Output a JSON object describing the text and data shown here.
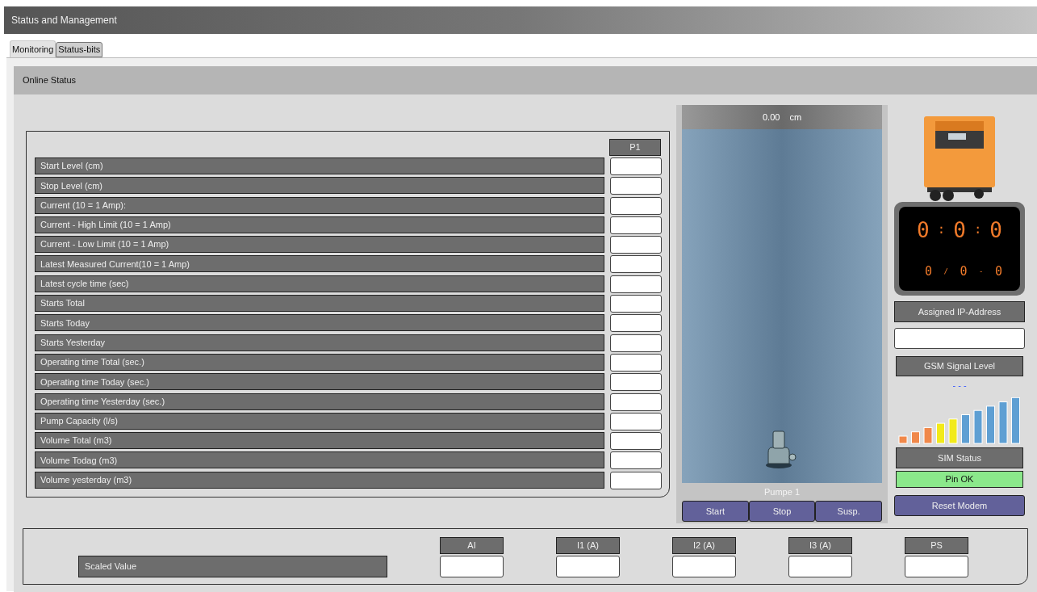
{
  "window": {
    "title": "Status and Management"
  },
  "tabs": [
    {
      "label": "Monitoring",
      "selected": true
    },
    {
      "label": "Status-bits",
      "selected": false
    }
  ],
  "panel": {
    "title": "Online Status"
  },
  "parameters": {
    "column": "P1",
    "rows": [
      "Start Level (cm)",
      "Stop Level (cm)",
      "Current (10 = 1 Amp):",
      "Current - High Limit (10 = 1 Amp)",
      "Current - Low Limit (10 = 1 Amp)",
      "Latest Measured Current(10 = 1 Amp)",
      "Latest cycle time (sec)",
      "Starts Total",
      "Starts Today",
      "Starts Yesterday",
      "Operating time Total (sec.)",
      "Operating time Today (sec.)",
      "Operating time Yesterday (sec.)",
      "Pump Capacity (l/s)",
      "Volume Total (m3)",
      "Volume Todag (m3)",
      "Volume yesterday (m3)"
    ]
  },
  "tank": {
    "value": "0.00",
    "unit": "cm",
    "pump_label": "Pumpe 1",
    "buttons": [
      "Start",
      "Stop",
      "Susp."
    ]
  },
  "display": {
    "time": [
      "0",
      ":",
      "0",
      ":",
      "0"
    ],
    "date": [
      "0",
      "/",
      "0",
      "-",
      "0"
    ]
  },
  "modem": {
    "ip_label": "Assigned IP-Address",
    "gsm_label": "GSM Signal Level",
    "gsm_reading": "- - -",
    "sim_label": "SIM Status",
    "sim_value": "Pin OK",
    "sim_ok": true,
    "reset_button": "Reset Modem"
  },
  "scaled": {
    "label": "Scaled Value",
    "columns": [
      "AI",
      "I1 (A)",
      "I2 (A)",
      "I3 (A)",
      "PS"
    ]
  }
}
